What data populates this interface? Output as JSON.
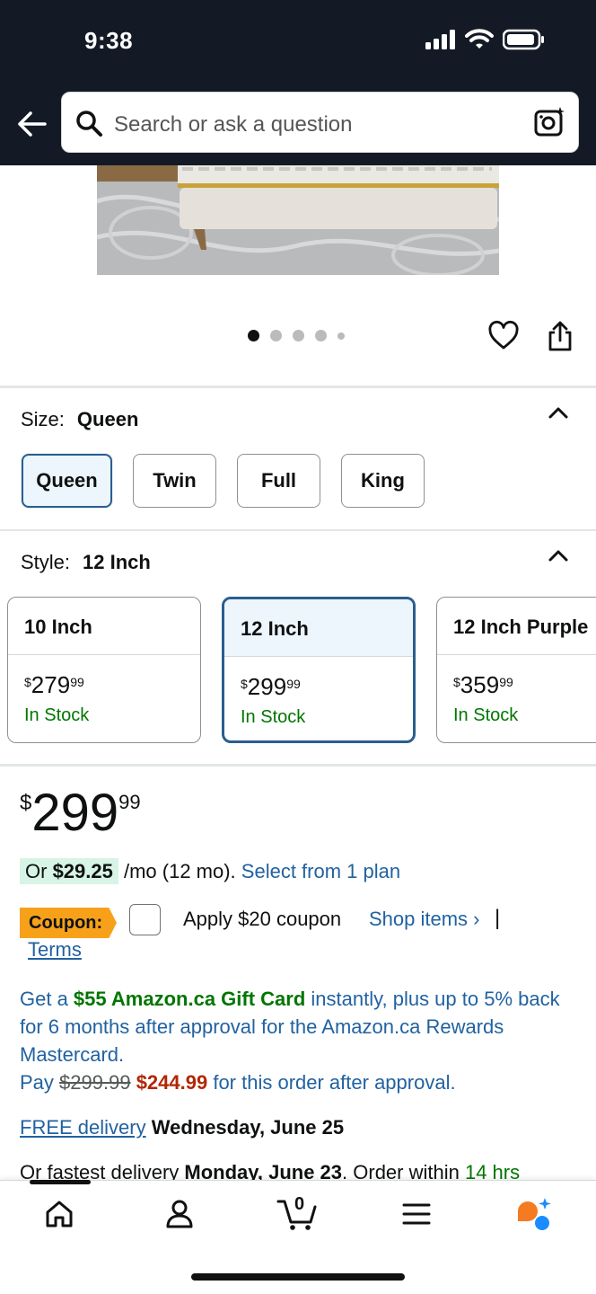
{
  "status_bar": {
    "time": "9:38"
  },
  "search": {
    "placeholder": "Search or ask a question"
  },
  "colors": {
    "accent_blue": "#2a5e8e",
    "link": "#2162a1",
    "in_stock": "#007600",
    "coupon": "#f7a11a",
    "deal_red": "#b12704",
    "topbar": "#131a26"
  },
  "icons": [
    "back-arrow-icon",
    "search-icon",
    "camera-icon",
    "heart-icon",
    "share-icon",
    "chevron-up-icon",
    "home-icon",
    "account-icon",
    "cart-icon",
    "menu-icon",
    "rufus-icon"
  ],
  "carousel": {
    "total_dots": 5,
    "active_index": 0
  },
  "size": {
    "label": "Size:",
    "selected": "Queen",
    "options": [
      "Queen",
      "Twin",
      "Full",
      "King"
    ]
  },
  "style": {
    "label": "Style:",
    "selected": "12 Inch",
    "options": [
      {
        "name": "10 Inch",
        "currency": "$",
        "dollars": "279",
        "cents": "99",
        "stock": "In Stock"
      },
      {
        "name": "12 Inch",
        "currency": "$",
        "dollars": "299",
        "cents": "99",
        "stock": "In Stock"
      },
      {
        "name": "12 Inch Purple",
        "currency": "$",
        "dollars": "359",
        "cents": "99",
        "stock": "In Stock"
      }
    ]
  },
  "price": {
    "currency": "$",
    "dollars": "299",
    "cents": "99"
  },
  "monthly": {
    "prefix": "Or ",
    "amount": "$29.25",
    "suffix": " /mo (12 mo). ",
    "link": "Select from 1 plan"
  },
  "coupon": {
    "tag": "Coupon:",
    "text": "Apply $20 coupon",
    "shop": "Shop items ›",
    "separator": "|",
    "terms": "Terms"
  },
  "gift": {
    "t1": "Get a ",
    "amount": "$55 Amazon.ca Gift Card",
    "t2": " instantly, plus up to 5% back for 6 months after approval for the Amazon.ca Rewards Mastercard.",
    "pay": "Pay ",
    "old_price": "$299.99",
    "new_price": "$244.99",
    "t3": " for this order after approval."
  },
  "delivery": {
    "link": "FREE delivery",
    "date": "Wednesday, June 25"
  },
  "fastest": {
    "t1": "Or fastest delivery ",
    "date": "Monday, June 23",
    "t2": ". Order within ",
    "time": "14 hrs"
  },
  "nav": {
    "cart_count": "0"
  }
}
